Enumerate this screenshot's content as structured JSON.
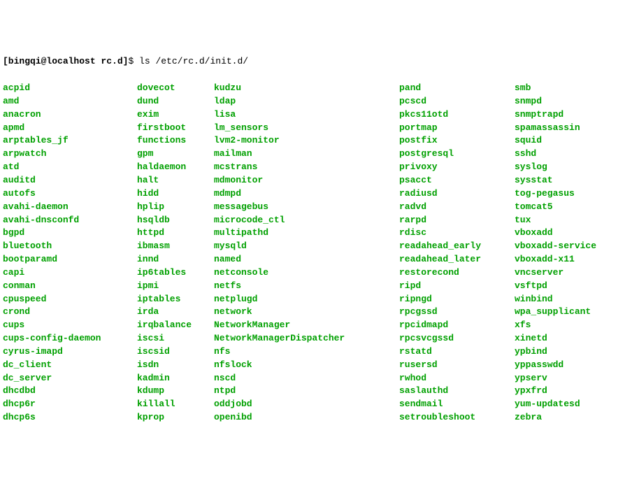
{
  "prompt": {
    "userhost": "[bingqi@localhost rc.d]",
    "dollar": "$ ",
    "command": "ls /etc/rc.d/init.d/"
  },
  "columns": {
    "c1": [
      "acpid",
      "amd",
      "anacron",
      "apmd",
      "arptables_jf",
      "arpwatch",
      "atd",
      "auditd",
      "autofs",
      "avahi-daemon",
      "avahi-dnsconfd",
      "bgpd",
      "bluetooth",
      "bootparamd",
      "capi",
      "conman",
      "cpuspeed",
      "crond",
      "cups",
      "cups-config-daemon",
      "cyrus-imapd",
      "dc_client",
      "dc_server",
      "dhcdbd",
      "dhcp6r",
      "dhcp6s"
    ],
    "c2": [
      "dovecot",
      "dund",
      "exim",
      "firstboot",
      "functions",
      "gpm",
      "haldaemon",
      "halt",
      "hidd",
      "hplip",
      "hsqldb",
      "httpd",
      "ibmasm",
      "innd",
      "ip6tables",
      "ipmi",
      "iptables",
      "irda",
      "irqbalance",
      "iscsi",
      "iscsid",
      "isdn",
      "kadmin",
      "kdump",
      "killall",
      "kprop"
    ],
    "c3": [
      "kudzu",
      "ldap",
      "lisa",
      "lm_sensors",
      "lvm2-monitor",
      "mailman",
      "mcstrans",
      "mdmonitor",
      "mdmpd",
      "messagebus",
      "microcode_ctl",
      "multipathd",
      "mysqld",
      "named",
      "netconsole",
      "netfs",
      "netplugd",
      "network",
      "NetworkManager",
      "NetworkManagerDispatcher",
      "nfs",
      "nfslock",
      "nscd",
      "ntpd",
      "oddjobd",
      "openibd"
    ],
    "c4": [
      "pand",
      "pcscd",
      "pkcs11otd",
      "portmap",
      "postfix",
      "postgresql",
      "privoxy",
      "psacct",
      "radiusd",
      "radvd",
      "rarpd",
      "rdisc",
      "readahead_early",
      "readahead_later",
      "restorecond",
      "ripd",
      "ripngd",
      "rpcgssd",
      "rpcidmapd",
      "rpcsvcgssd",
      "rstatd",
      "rusersd",
      "rwhod",
      "saslauthd",
      "sendmail",
      "setroubleshoot"
    ],
    "c5": [
      "smb",
      "snmpd",
      "snmptrapd",
      "spamassassin",
      "squid",
      "sshd",
      "syslog",
      "sysstat",
      "tog-pegasus",
      "tomcat5",
      "tux",
      "vboxadd",
      "vboxadd-service",
      "vboxadd-x11",
      "vncserver",
      "vsftpd",
      "winbind",
      "wpa_supplicant",
      "xfs",
      "xinetd",
      "ypbind",
      "yppasswdd",
      "ypserv",
      "ypxfrd",
      "yum-updatesd",
      "zebra"
    ]
  }
}
